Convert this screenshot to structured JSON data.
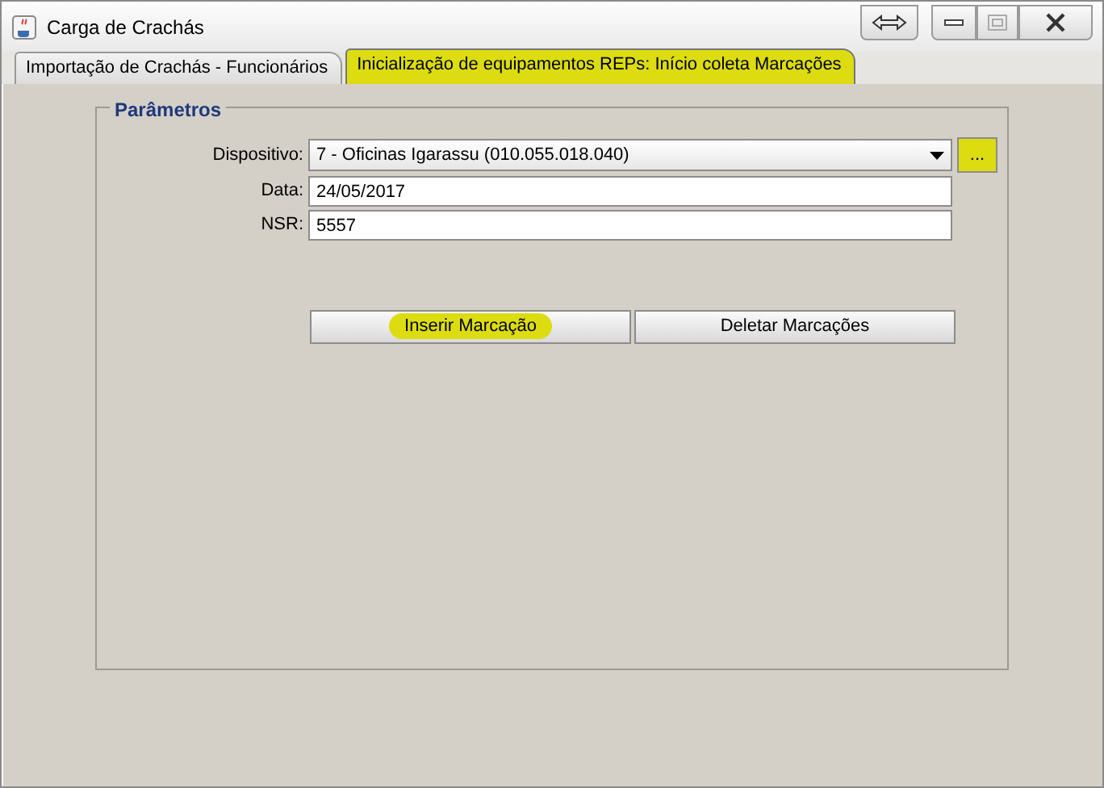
{
  "window": {
    "title": "Carga de Crachás"
  },
  "tabs": [
    {
      "label": "Importação de Crachás - Funcionários",
      "selected": false,
      "highlighted": false
    },
    {
      "label": "Inicialização de equipamentos REPs: Início coleta Marcações",
      "selected": true,
      "highlighted": true
    }
  ],
  "panel": {
    "legend": "Parâmetros",
    "fields": [
      {
        "kind": "combo",
        "label": "Dispositivo:",
        "value": "7 - Oficinas Igarassu (010.055.018.040)",
        "button": "...",
        "button_highlighted": true
      },
      {
        "kind": "text",
        "label": "Data:",
        "value": "24/05/2017"
      },
      {
        "kind": "text",
        "label": "NSR:",
        "value": "5557"
      }
    ],
    "buttons": [
      {
        "label": "Inserir Marcação",
        "highlighted": true
      },
      {
        "label": "Deletar Marcações",
        "highlighted": false
      }
    ]
  }
}
